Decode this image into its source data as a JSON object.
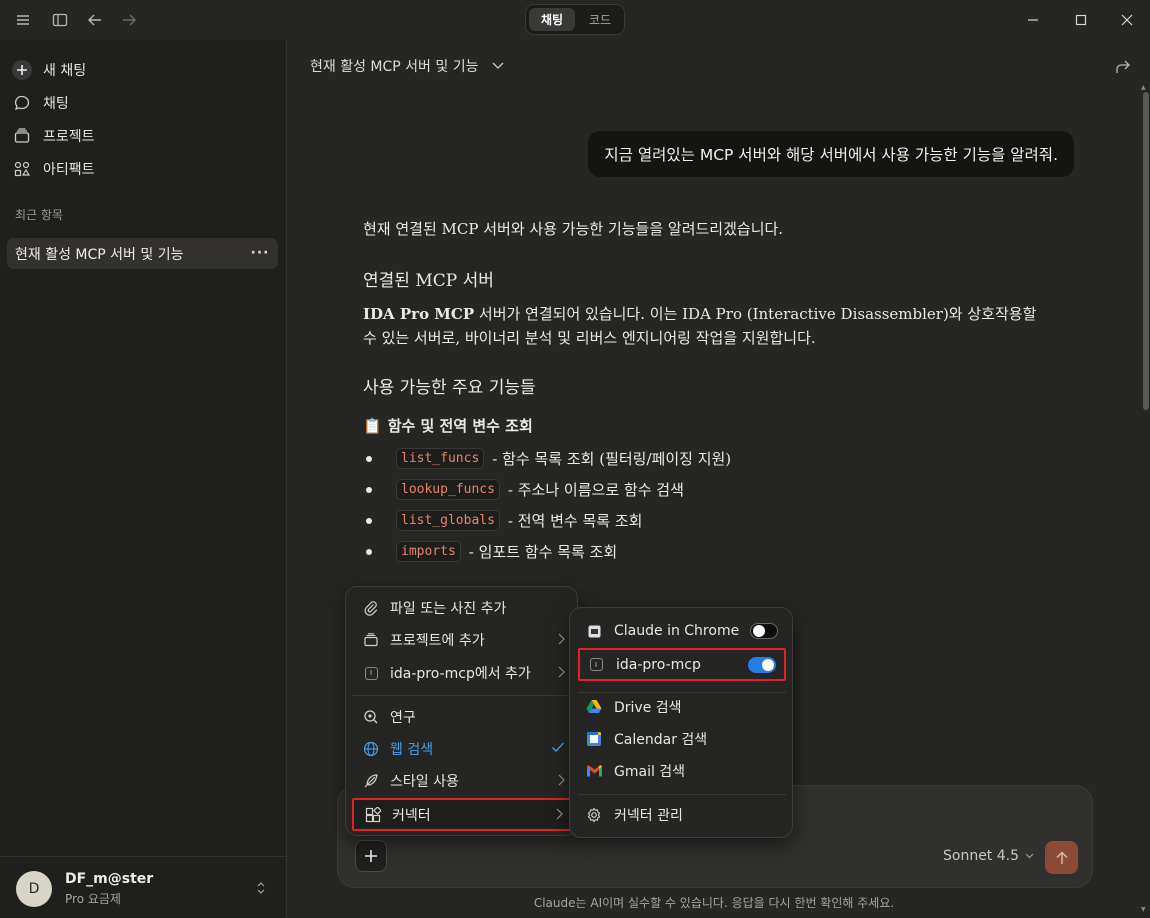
{
  "topbar": {
    "seg_chat": "채팅",
    "seg_code": "코드"
  },
  "sidebar": {
    "items": [
      {
        "label": "새 채팅",
        "icon": "plus-circle-icon"
      },
      {
        "label": "채팅",
        "icon": "chat-bubble-icon"
      },
      {
        "label": "프로젝트",
        "icon": "folder-stack-icon"
      },
      {
        "label": "아티팩트",
        "icon": "artifact-icon"
      }
    ],
    "recent_label": "최근 항목",
    "recent_item": "현재 활성 MCP 서버 및 기능",
    "recent_more": "···"
  },
  "user": {
    "avatar": "D",
    "name": "DF_m@ster",
    "plan": "Pro 요금제"
  },
  "conversation": {
    "title": "현재 활성 MCP 서버 및 기능",
    "user_message": "지금 열려있는 MCP 서버와 해당 서버에서 사용 가능한 기능을 알려줘.",
    "intro": "현재 연결된 MCP 서버와 사용 가능한 기능들을 알려드리겠습니다.",
    "h_servers": "연결된 MCP 서버",
    "server_bold": "IDA Pro MCP",
    "server_rest_1": " 서버가 연결되어 있습니다. 이는 IDA Pro (Interactive Disassembler)와 상호작용할",
    "server_rest_2": "수 있는 서버로, 바이너리 분석 및 리버스 엔지니어링 작업을 지원합니다.",
    "h_features": "사용 가능한 주요 기능들",
    "h_funcs_icon": "📋",
    "h_funcs": "함수 및 전역 변수 조회",
    "bullets": [
      {
        "code": "list_funcs",
        "desc": "- 함수 목록 조회 (필터링/페이징 지원)"
      },
      {
        "code": "lookup_funcs",
        "desc": "- 주소나 이름으로 함수 검색"
      },
      {
        "code": "list_globals",
        "desc": "- 전역 변수 목록 조회"
      },
      {
        "code": "imports",
        "desc": "- 임포트 함수 목록 조회"
      }
    ]
  },
  "input": {
    "model": "Sonnet 4.5",
    "disclaimer": "Claude는 AI이며 실수할 수 있습니다. 응답을 다시 한번 확인해 주세요."
  },
  "menu1": {
    "add_file": "파일 또는 사진 추가",
    "add_project": "프로젝트에 추가",
    "add_ida": "ida-pro-mcp에서 추가",
    "research": "연구",
    "web_search": "웹 검색",
    "style": "스타일 사용",
    "connector": "커넥터"
  },
  "menu2": {
    "chrome": "Claude in Chrome",
    "chrome_enabled": false,
    "ida": "ida-pro-mcp",
    "ida_enabled": true,
    "drive": "Drive 검색",
    "calendar": "Calendar 검색",
    "gmail": "Gmail 검색",
    "manage": "커넥터 관리"
  },
  "colors": {
    "accent_blue": "#4a9fe6",
    "toggle_on": "#2b7ce0",
    "highlight_red": "#e0202a",
    "send_button": "#8b4a37"
  }
}
